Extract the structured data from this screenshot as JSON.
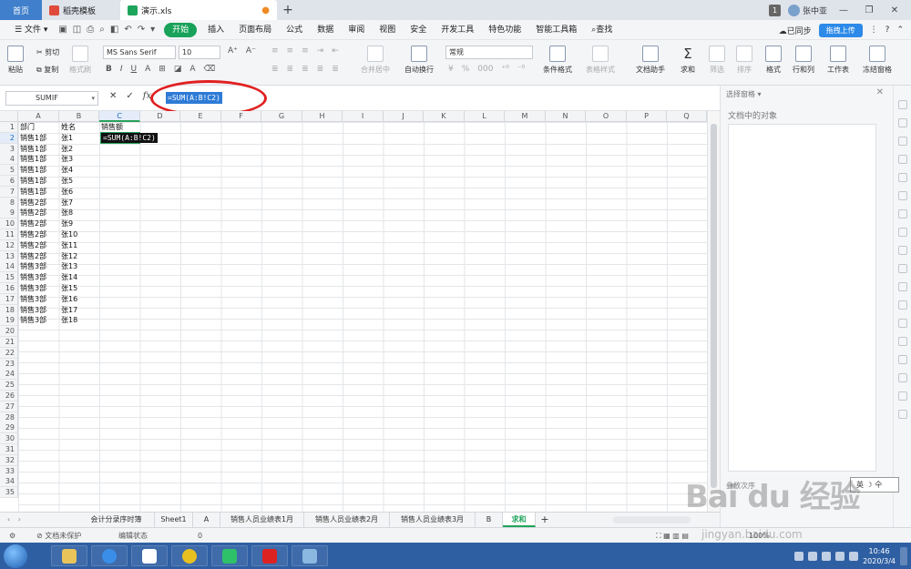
{
  "tabs": {
    "home": "首页",
    "template": "稻壳模板",
    "file": "演示.xls"
  },
  "titlebar": {
    "badge": "1",
    "user": "张中亚"
  },
  "menu": {
    "file": "文件",
    "items": [
      "开始",
      "插入",
      "页面布局",
      "公式",
      "数据",
      "审阅",
      "视图",
      "安全",
      "开发工具",
      "特色功能",
      "智能工具箱"
    ],
    "search": "查找",
    "sync": "已同步",
    "upload": "拖拽上传",
    "help": "?"
  },
  "ribbon": {
    "paste": "粘贴",
    "cut": "剪切",
    "copy": "复制",
    "format_painter": "格式刷",
    "font": "MS Sans Serif",
    "size": "10",
    "merge": "合并居中",
    "wrap": "自动换行",
    "number_format": "常规",
    "conditional": "条件格式",
    "table_style": "表格样式",
    "doc_helper": "文档助手",
    "sum": "求和",
    "filter": "筛选",
    "sort": "排序",
    "format": "格式",
    "row_col": "行和列",
    "worksheet": "工作表",
    "freeze": "冻结窗格"
  },
  "formula_bar": {
    "name_box": "SUMIF",
    "fx": "fx",
    "formula": "=SUM(A:B!C2)"
  },
  "columns": [
    "A",
    "B",
    "C",
    "D",
    "E",
    "F",
    "G",
    "H",
    "I",
    "J",
    "K",
    "L",
    "M",
    "N",
    "O",
    "P",
    "Q"
  ],
  "rows": [
    "1",
    "2",
    "3",
    "4",
    "5",
    "6",
    "7",
    "8",
    "9",
    "10",
    "11",
    "12",
    "13",
    "14",
    "15",
    "16",
    "17",
    "18",
    "19",
    "20",
    "21",
    "22",
    "23",
    "24",
    "25",
    "26",
    "27",
    "28",
    "29",
    "30",
    "31",
    "32",
    "33",
    "34",
    "35"
  ],
  "header_row": {
    "a": "部门",
    "b": "姓名",
    "c": "销售额"
  },
  "data_rows": [
    {
      "a": "销售1部",
      "b": "张1"
    },
    {
      "a": "销售1部",
      "b": "张2"
    },
    {
      "a": "销售1部",
      "b": "张3"
    },
    {
      "a": "销售1部",
      "b": "张4"
    },
    {
      "a": "销售1部",
      "b": "张5"
    },
    {
      "a": "销售1部",
      "b": "张6"
    },
    {
      "a": "销售2部",
      "b": "张7"
    },
    {
      "a": "销售2部",
      "b": "张8"
    },
    {
      "a": "销售2部",
      "b": "张9"
    },
    {
      "a": "销售2部",
      "b": "张10"
    },
    {
      "a": "销售2部",
      "b": "张11"
    },
    {
      "a": "销售2部",
      "b": "张12"
    },
    {
      "a": "销售3部",
      "b": "张13"
    },
    {
      "a": "销售3部",
      "b": "张14"
    },
    {
      "a": "销售3部",
      "b": "张15"
    },
    {
      "a": "销售3部",
      "b": "张16"
    },
    {
      "a": "销售3部",
      "b": "张17"
    },
    {
      "a": "销售3部",
      "b": "张18"
    }
  ],
  "editing_cell": "=SUM(A:B!C2)",
  "sheets": [
    "会计分录序时簿",
    "Sheet1",
    "A",
    "销售人员业绩表1月",
    "销售人员业绩表2月",
    "销售人员业绩表3月",
    "B",
    "求和"
  ],
  "active_sheet": "求和",
  "side_pane": {
    "title": "选择窗格",
    "subtitle": "文档中的对象",
    "order": "叠放次序",
    "ime": "英 ☽ 仐"
  },
  "status": {
    "protect": "文档未保护",
    "edit_state": "编辑状态",
    "value": "0",
    "zoom": "100%"
  },
  "watermark": {
    "brand": "Bai du 经验",
    "url": "jingyan.baidu.com"
  },
  "taskbar": {
    "time": "10:46",
    "date": "2020/3/4"
  }
}
